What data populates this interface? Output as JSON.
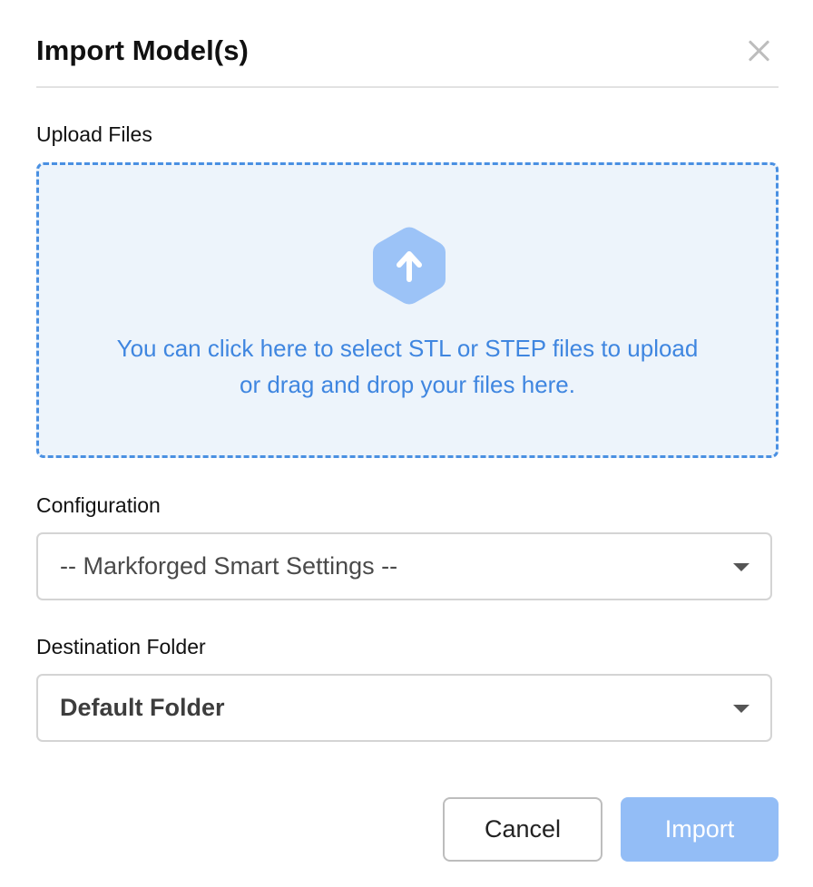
{
  "dialog": {
    "title": "Import Model(s)",
    "close_icon": "close-icon"
  },
  "upload": {
    "label": "Upload Files",
    "icon": "upload-arrow-icon",
    "line1": "You can click here to select STL or STEP files to upload",
    "line2": "or drag and drop your files here."
  },
  "configuration": {
    "label": "Configuration",
    "selected": "-- Markforged Smart Settings --"
  },
  "destination": {
    "label": "Destination Folder",
    "selected": "Default Folder"
  },
  "actions": {
    "cancel_label": "Cancel",
    "import_label": "Import"
  },
  "colors": {
    "accent": "#4a90e2",
    "dropzone_bg": "#edf4fb",
    "import_disabled": "#93bdf6",
    "icon_fill": "#9cc3f7"
  }
}
